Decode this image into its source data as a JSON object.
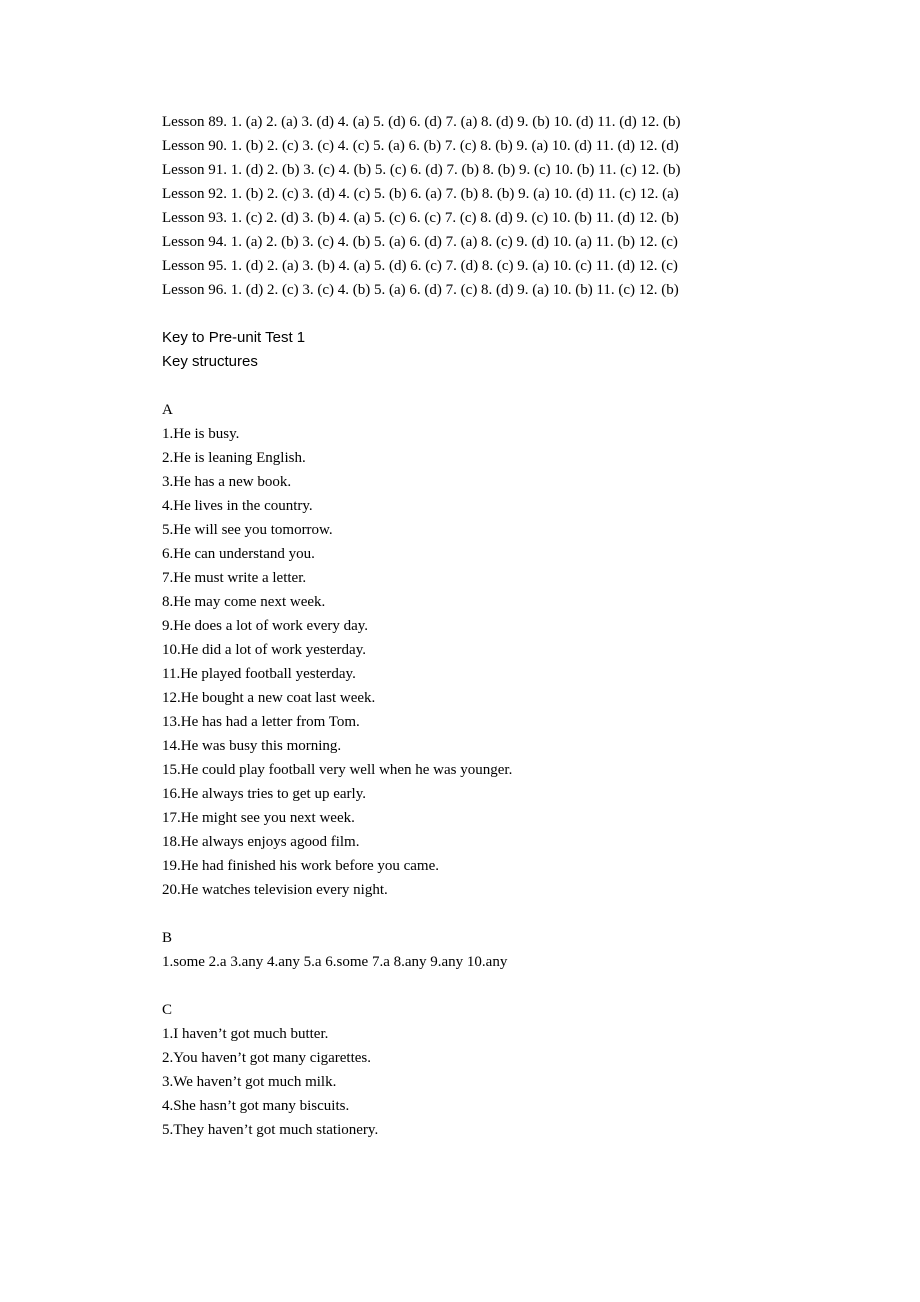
{
  "lessons": [
    "Lesson 89. 1. (a) 2. (a) 3. (d) 4. (a) 5. (d) 6. (d) 7. (a) 8. (d) 9. (b) 10. (d) 11. (d) 12. (b)",
    "Lesson 90. 1. (b) 2. (c) 3. (c) 4. (c) 5. (a) 6. (b) 7. (c) 8. (b) 9. (a) 10. (d) 11. (d) 12. (d)",
    "Lesson 91. 1. (d) 2. (b) 3. (c) 4. (b) 5. (c) 6. (d) 7. (b) 8. (b) 9. (c) 10. (b) 11. (c) 12. (b)",
    "Lesson 92. 1. (b) 2. (c) 3. (d) 4. (c) 5. (b) 6. (a) 7. (b) 8. (b) 9. (a) 10. (d) 11. (c) 12. (a)",
    "Lesson 93. 1. (c) 2. (d) 3. (b) 4. (a) 5. (c) 6. (c) 7. (c) 8. (d) 9. (c) 10. (b) 11. (d) 12. (b)",
    "Lesson 94. 1. (a) 2. (b) 3. (c) 4. (b) 5. (a) 6. (d) 7. (a) 8. (c) 9. (d) 10. (a) 11. (b) 12. (c)",
    "Lesson 95. 1. (d) 2. (a) 3. (b) 4. (a) 5. (d) 6. (c) 7. (d) 8. (c) 9. (a) 10. (c) 11. (d) 12. (c)",
    "Lesson 96. 1. (d) 2. (c) 3. (c) 4. (b) 5. (a) 6. (d) 7. (c) 8. (d) 9. (a) 10. (b) 11. (c) 12. (b)"
  ],
  "headings": {
    "keyPreUnit": "Key to Pre-unit Test 1",
    "keyStructures": "Key structures"
  },
  "sectionA": {
    "label": "A",
    "items": [
      "1.He is busy.",
      "2.He is leaning English.",
      "3.He has a new book.",
      "4.He lives in the country.",
      "5.He will see you tomorrow.",
      "6.He can understand you.",
      "7.He must write a letter.",
      "8.He may come next week.",
      "9.He does a lot of work every day.",
      "10.He did a lot of work yesterday.",
      "11.He played football yesterday.",
      "12.He bought a new coat last week.",
      "13.He has had a letter from Tom.",
      "14.He was busy this morning.",
      "15.He could play football very well when he was younger.",
      "16.He always tries to get up early.",
      "17.He might see you next week.",
      "18.He always enjoys agood film.",
      "19.He had finished his work before you came.",
      "20.He watches television every night."
    ]
  },
  "sectionB": {
    "label": "B",
    "line": "1.some 2.a 3.any 4.any 5.a 6.some 7.a 8.any 9.any 10.any"
  },
  "sectionC": {
    "label": "C",
    "items": [
      "1.I haven’t got much butter.",
      "2.You haven’t got many cigarettes.",
      "3.We haven’t got much milk.",
      "4.She hasn’t got many biscuits.",
      "5.They haven’t got much stationery."
    ]
  }
}
